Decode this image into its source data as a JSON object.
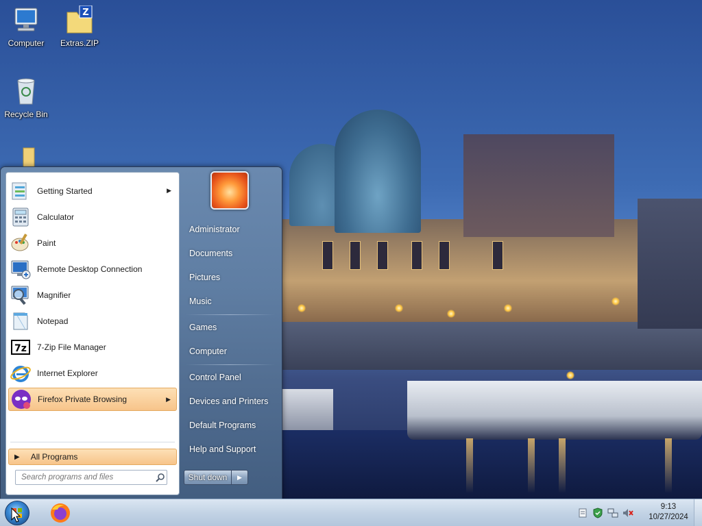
{
  "desktop": {
    "icons": [
      {
        "label": "Computer",
        "icon": "computer-icon"
      },
      {
        "label": "Extras.ZIP",
        "icon": "zip-folder-icon"
      },
      {
        "label": "Recycle Bin",
        "icon": "recycle-bin-icon"
      },
      {
        "label": "",
        "icon": "folder-icon"
      }
    ]
  },
  "start_menu": {
    "programs": [
      {
        "label": "Getting Started",
        "icon": "getting-started-icon",
        "has_submenu": true
      },
      {
        "label": "Calculator",
        "icon": "calculator-icon",
        "has_submenu": false
      },
      {
        "label": "Paint",
        "icon": "paint-icon",
        "has_submenu": false
      },
      {
        "label": "Remote Desktop Connection",
        "icon": "remote-desktop-icon",
        "has_submenu": false
      },
      {
        "label": "Magnifier",
        "icon": "magnifier-icon",
        "has_submenu": false
      },
      {
        "label": "Notepad",
        "icon": "notepad-icon",
        "has_submenu": false
      },
      {
        "label": "7-Zip File Manager",
        "icon": "7zip-icon",
        "has_submenu": false
      },
      {
        "label": "Internet Explorer",
        "icon": "internet-explorer-icon",
        "has_submenu": false
      },
      {
        "label": "Firefox Private Browsing",
        "icon": "firefox-private-icon",
        "has_submenu": true,
        "highlighted": true
      }
    ],
    "all_programs_label": "All Programs",
    "search_placeholder": "Search programs and files",
    "right_items": [
      "Administrator",
      "Documents",
      "Pictures",
      "Music",
      "Games",
      "Computer",
      "Control Panel",
      "Devices and Printers",
      "Default Programs",
      "Help and Support"
    ],
    "shutdown_label": "Shut down"
  },
  "taskbar": {
    "pinned": [
      "firefox-icon"
    ],
    "tray_icons": [
      "action-center-icon",
      "security-shield-icon",
      "network-icon",
      "volume-muted-icon"
    ],
    "clock_time": "9:13",
    "clock_date": "10/27/2024"
  },
  "colors": {
    "menu_highlight": "#f7c48a",
    "menu_frame": "#6e8caf",
    "taskbar": "#c3d3e5"
  }
}
